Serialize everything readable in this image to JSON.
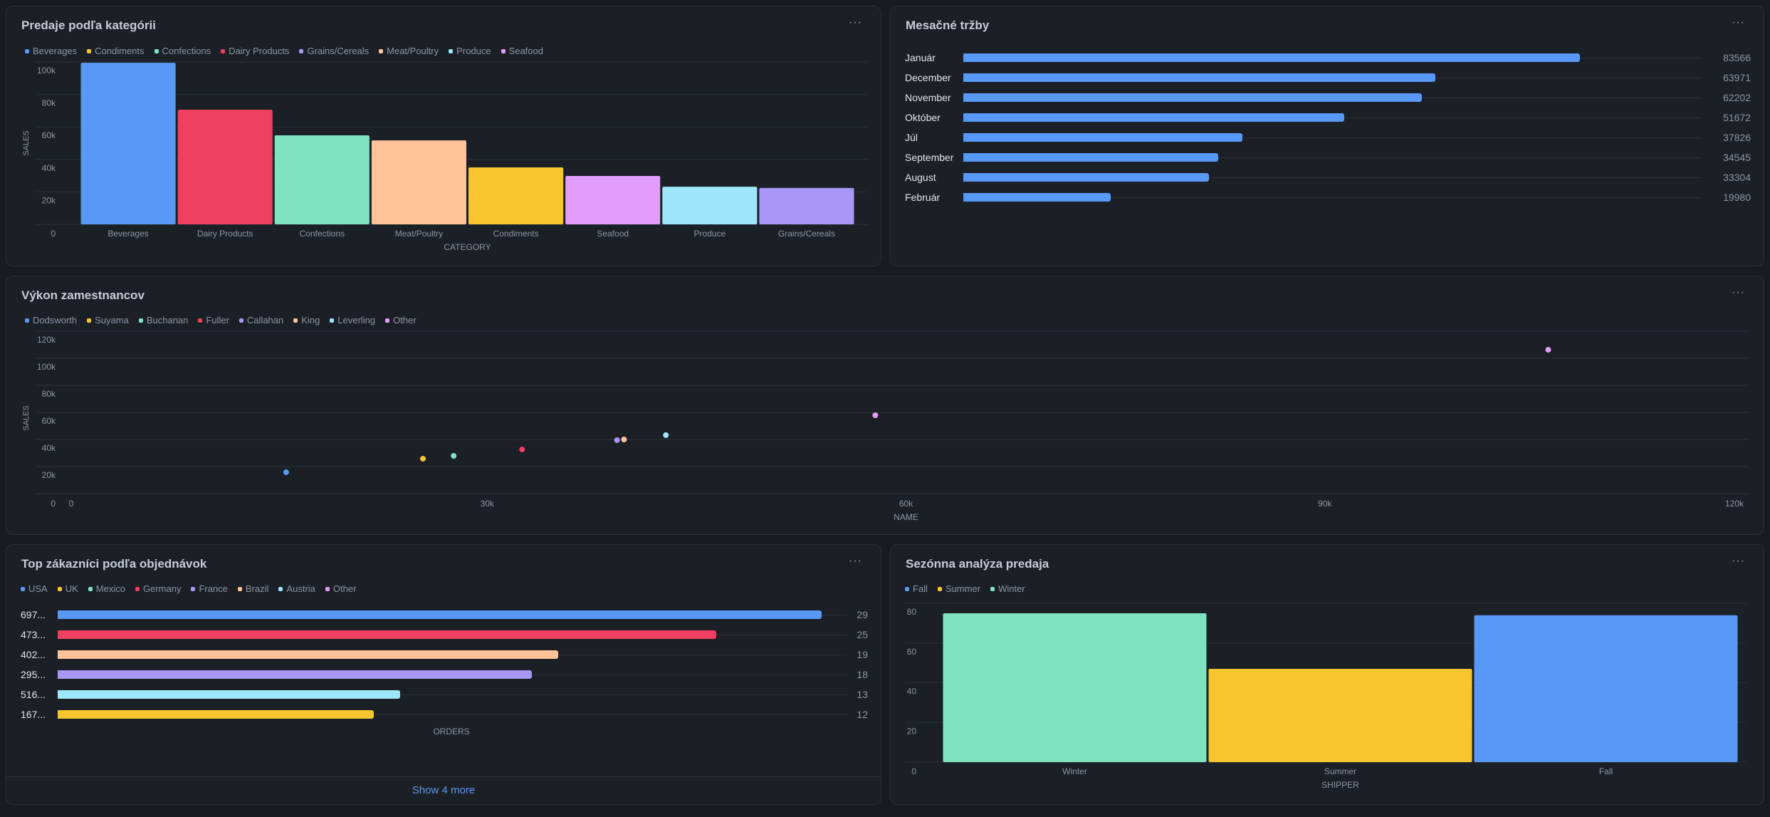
{
  "colors": {
    "blue": "#5899f8",
    "yellow": "#f7c52d",
    "green": "#7fe3c2",
    "red": "#ef405f",
    "purple": "#a897f6",
    "peach": "#fec398",
    "cyan": "#9de6fc",
    "pink": "#e29cf9"
  },
  "panels": {
    "category": {
      "title": "Predaje podľa kategórii",
      "menu": "···",
      "legend": [
        {
          "label": "Beverages",
          "color": "#5899f8"
        },
        {
          "label": "Condiments",
          "color": "#f7c52d"
        },
        {
          "label": "Confections",
          "color": "#7fe3c2"
        },
        {
          "label": "Dairy Products",
          "color": "#ef405f"
        },
        {
          "label": "Grains/Cereals",
          "color": "#a897f6"
        },
        {
          "label": "Meat/Poultry",
          "color": "#fec398"
        },
        {
          "label": "Produce",
          "color": "#9de6fc"
        },
        {
          "label": "Seafood",
          "color": "#e29cf9"
        }
      ]
    },
    "monthly": {
      "title": "Mesačné tržby",
      "menu": "···"
    },
    "employees": {
      "title": "Výkon zamestnancov",
      "menu": "···",
      "legend": [
        {
          "label": "Dodsworth",
          "color": "#5899f8"
        },
        {
          "label": "Suyama",
          "color": "#f7c52d"
        },
        {
          "label": "Buchanan",
          "color": "#7fe3c2"
        },
        {
          "label": "Fuller",
          "color": "#ef405f"
        },
        {
          "label": "Callahan",
          "color": "#a897f6"
        },
        {
          "label": "King",
          "color": "#fec398"
        },
        {
          "label": "Leverling",
          "color": "#9de6fc"
        },
        {
          "label": "Other",
          "color": "#e29cf9"
        }
      ]
    },
    "customers": {
      "title": "Top zákazníci podľa objednávok",
      "menu": "···",
      "legend": [
        {
          "label": "USA",
          "color": "#5899f8"
        },
        {
          "label": "UK",
          "color": "#f7c52d"
        },
        {
          "label": "Mexico",
          "color": "#7fe3c2"
        },
        {
          "label": "Germany",
          "color": "#ef405f"
        },
        {
          "label": "France",
          "color": "#a897f6"
        },
        {
          "label": "Brazil",
          "color": "#fec398"
        },
        {
          "label": "Austria",
          "color": "#9de6fc"
        },
        {
          "label": "Other",
          "color": "#e29cf9"
        }
      ],
      "show_more": "Show 4 more"
    },
    "seasonal": {
      "title": "Sezónna analýza predaja",
      "menu": "···",
      "legend": [
        {
          "label": "Fall",
          "color": "#5899f8"
        },
        {
          "label": "Summer",
          "color": "#f7c52d"
        },
        {
          "label": "Winter",
          "color": "#7fe3c2"
        }
      ]
    }
  },
  "chart_data": [
    {
      "id": "category",
      "type": "bar",
      "title": "Predaje podľa kategórii",
      "xlabel": "CATEGORY",
      "ylabel": "SALES",
      "categories": [
        "Beverages",
        "Dairy Products",
        "Confections",
        "Meat/Poultry",
        "Condiments",
        "Seafood",
        "Produce",
        "Grains/Cereals"
      ],
      "values": [
        99500,
        70600,
        54800,
        51700,
        35100,
        29800,
        23200,
        22400
      ],
      "colors": [
        "#5899f8",
        "#ef405f",
        "#7fe3c2",
        "#fec398",
        "#f7c52d",
        "#e29cf9",
        "#9de6fc",
        "#a897f6"
      ],
      "yticks": [
        0,
        20000,
        40000,
        60000,
        80000,
        100000
      ],
      "ytick_labels": [
        "0",
        "20k",
        "40k",
        "60k",
        "80k",
        "100k"
      ],
      "ylim": [
        0,
        100000
      ],
      "grid": true,
      "legend": "top-left"
    },
    {
      "id": "monthly",
      "type": "bar",
      "orientation": "horizontal",
      "title": "Mesačné tržby",
      "categories": [
        "Január",
        "December",
        "November",
        "Október",
        "Júl",
        "September",
        "August",
        "Február"
      ],
      "values": [
        83566,
        63971,
        62202,
        51672,
        37826,
        34545,
        33304,
        19980
      ],
      "xlim": [
        0,
        100000
      ],
      "color": "#5899f8"
    },
    {
      "id": "employees",
      "type": "scatter",
      "title": "Výkon zamestnancov",
      "xlabel": "NAME",
      "ylabel": "SALES",
      "xticks": [
        0,
        30000,
        60000,
        90000,
        120000
      ],
      "xtick_labels": [
        "0",
        "30k",
        "60k",
        "90k",
        "120k"
      ],
      "yticks": [
        0,
        20000,
        40000,
        60000,
        80000,
        100000,
        120000
      ],
      "ytick_labels": [
        "0",
        "20k",
        "40k",
        "60k",
        "80k",
        "100k",
        "120k"
      ],
      "xlim": [
        0,
        120000
      ],
      "ylim": [
        0,
        120000
      ],
      "grid": true,
      "legend": "top-left",
      "series": [
        {
          "name": "Dodsworth",
          "color": "#5899f8",
          "points": [
            [
              15600,
              15800
            ]
          ]
        },
        {
          "name": "Suyama",
          "color": "#f7c52d",
          "points": [
            [
              25400,
              25800
            ]
          ]
        },
        {
          "name": "Buchanan",
          "color": "#7fe3c2",
          "points": [
            [
              27600,
              27900
            ]
          ]
        },
        {
          "name": "Fuller",
          "color": "#ef405f",
          "points": [
            [
              32500,
              32600
            ]
          ]
        },
        {
          "name": "Callahan",
          "color": "#a897f6",
          "points": [
            [
              39300,
              39500
            ]
          ]
        },
        {
          "name": "King",
          "color": "#fec398",
          "points": [
            [
              39800,
              40000
            ]
          ]
        },
        {
          "name": "Leverling",
          "color": "#9de6fc",
          "points": [
            [
              42800,
              43200
            ]
          ]
        },
        {
          "name": "Other",
          "color": "#e29cf9",
          "points": [
            [
              57800,
              57900
            ],
            [
              106000,
              106300
            ]
          ]
        }
      ]
    },
    {
      "id": "customers",
      "type": "bar",
      "orientation": "horizontal",
      "title": "Top zákazníci podľa objednávok",
      "xlabel": "ORDERS",
      "categories": [
        "697...",
        "473...",
        "402...",
        "295...",
        "516...",
        "167..."
      ],
      "values": [
        29,
        25,
        19,
        18,
        13,
        12
      ],
      "colors": [
        "#5899f8",
        "#ef405f",
        "#fec398",
        "#a897f6",
        "#9de6fc",
        "#f7c52d"
      ],
      "xlim": [
        0,
        30
      ]
    },
    {
      "id": "seasonal",
      "type": "bar",
      "title": "Sezónna analýza predaja",
      "xlabel": "SHIPPER",
      "categories": [
        "Winter",
        "Summer",
        "Fall"
      ],
      "values": [
        75,
        47,
        74
      ],
      "colors": [
        "#7fe3c2",
        "#f7c52d",
        "#5899f8"
      ],
      "yticks": [
        0,
        20,
        40,
        60,
        80
      ],
      "ytick_labels": [
        "0",
        "20",
        "40",
        "60",
        "80"
      ],
      "ylim": [
        0,
        80
      ],
      "grid": true,
      "legend": "top-left"
    }
  ]
}
